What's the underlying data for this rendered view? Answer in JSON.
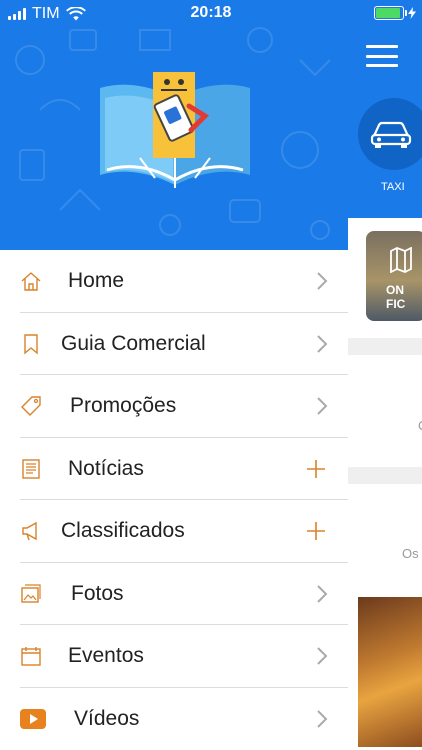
{
  "status_bar": {
    "carrier": "TIM",
    "time": "20:18"
  },
  "menu": {
    "items": [
      {
        "label": "Home",
        "icon": "home-icon",
        "action": "chevron"
      },
      {
        "label": "Guia Comercial",
        "icon": "bookmark-icon",
        "action": "chevron"
      },
      {
        "label": "Promoções",
        "icon": "tag-icon",
        "action": "chevron"
      },
      {
        "label": "Notícias",
        "icon": "newspaper-icon",
        "action": "plus"
      },
      {
        "label": "Classificados",
        "icon": "megaphone-icon",
        "action": "plus"
      },
      {
        "label": "Fotos",
        "icon": "photos-icon",
        "action": "chevron"
      },
      {
        "label": "Eventos",
        "icon": "calendar-icon",
        "action": "chevron"
      },
      {
        "label": "Vídeos",
        "icon": "video-icon",
        "action": "chevron"
      }
    ]
  },
  "background": {
    "taxi_label": "TAXI",
    "card_text_line1": "ON",
    "card_text_line2": "FIC",
    "partial_text_c": "C",
    "partial_text_os": "Os"
  },
  "colors": {
    "primary_blue": "#1a7ae8",
    "accent_orange": "#d9822b",
    "battery_green": "#4cd964"
  }
}
